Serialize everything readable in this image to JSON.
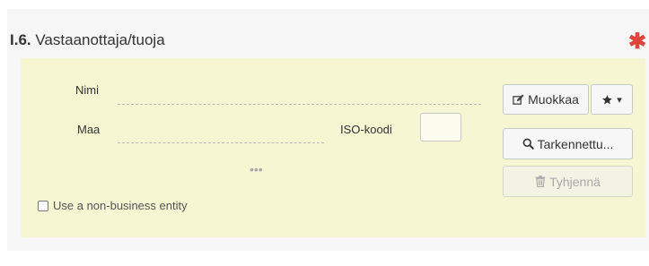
{
  "section": {
    "number": "I.6.",
    "title": "Vastaanottaja/tuoja",
    "required_mark": "✱"
  },
  "form": {
    "name_label": "Nimi",
    "country_label": "Maa",
    "iso_label": "ISO-koodi",
    "more_dots": "•••",
    "non_business_label": "Use a non-business entity"
  },
  "buttons": {
    "edit_label": "Muokkaa",
    "favorites_caret": "▾",
    "advanced_label": "Tarkennettu...",
    "clear_label": "Tyhjennä"
  },
  "colors": {
    "panel_bg": "#f6f6d3",
    "required": "#e0443a"
  },
  "icons": [
    "edit-icon",
    "star-icon",
    "search-icon",
    "trash-icon",
    "checkbox-icon"
  ]
}
